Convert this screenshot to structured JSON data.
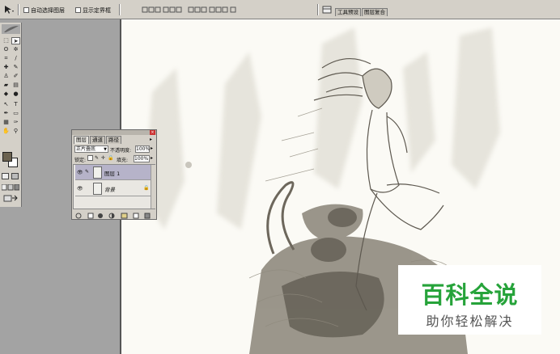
{
  "options_bar": {
    "checkbox_autoselect_label": "自动选择图层",
    "checkbox_transform_label": "显示定界框"
  },
  "palette_well": {
    "tab_tools": "工具预设",
    "tab_layers": "图层复合"
  },
  "layers_panel": {
    "tabs": [
      "图层",
      "通道",
      "路径"
    ],
    "blend_mode": "正片叠底",
    "opacity_label": "不透明度:",
    "opacity_value": "100%",
    "lock_label": "锁定:",
    "fill_label": "填充:",
    "fill_value": "100%",
    "layers": [
      {
        "name": "图层 1",
        "selected": true
      },
      {
        "name": "背景",
        "selected": false
      }
    ]
  },
  "watermark": {
    "title": "百科全说",
    "subtitle": "助你轻松解决",
    "color": "#26a33a"
  },
  "colors": {
    "ui_face": "#d4d0c8",
    "workspace": "#a3a3a3",
    "canvas": "#fbfaf5",
    "foreground_swatch": "#6b6250",
    "selected_layer": "#b6b3c9"
  }
}
